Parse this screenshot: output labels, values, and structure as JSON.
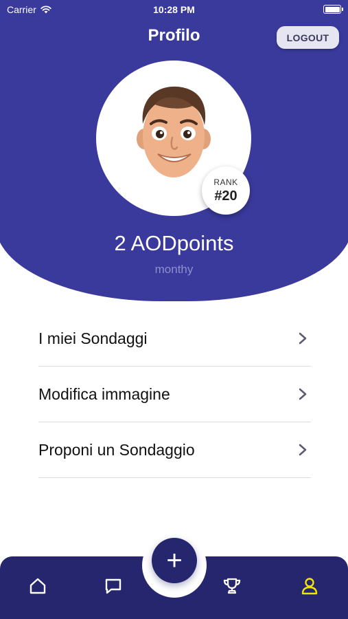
{
  "status_bar": {
    "carrier": "Carrier",
    "time": "10:28 PM"
  },
  "header": {
    "title": "Profilo",
    "logout_label": "LOGOUT"
  },
  "profile": {
    "rank_label": "RANK",
    "rank_value": "#20",
    "points": "2 AODpoints",
    "username": "monthy"
  },
  "menu": {
    "items": [
      {
        "label": "I miei Sondaggi"
      },
      {
        "label": "Modifica immagine"
      },
      {
        "label": "Proponi un Sondaggio"
      }
    ]
  },
  "tabbar": {
    "fab_symbol": "+",
    "tabs": [
      {
        "icon": "home-icon"
      },
      {
        "icon": "chat-icon"
      },
      {
        "icon": "trophy-icon"
      },
      {
        "icon": "user-icon",
        "active": true
      }
    ],
    "active_color": "#f2e600"
  },
  "colors": {
    "primary": "#3a3a9c",
    "tabbar": "#26266e",
    "accent": "#f2e600"
  }
}
